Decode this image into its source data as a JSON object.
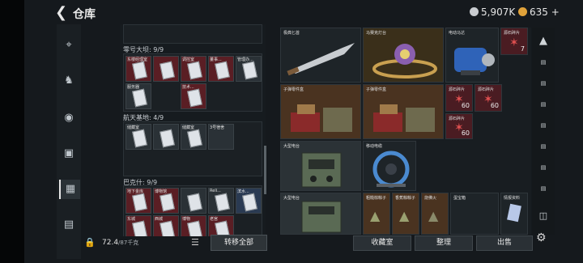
{
  "header": {
    "title": "仓库",
    "currency_silver": "5,907K",
    "currency_gold": "635",
    "gold_plus": "+"
  },
  "left_panel": {
    "sections": [
      {
        "label": "零号大坝: 9/9",
        "slots": [
          {
            "name": "东楼经理室",
            "color": "red"
          },
          {
            "name": "",
            "color": "red"
          },
          {
            "name": "调控室",
            "color": "red"
          },
          {
            "name": "董事...",
            "color": "red"
          },
          {
            "name": "管理办...",
            "color": "grey"
          },
          {
            "name": "服务器",
            "color": "grey"
          },
          {
            "name": "技术...",
            "color": "red"
          }
        ]
      },
      {
        "label": "航天基地: 4/9",
        "slots": [
          {
            "name": "储藏室",
            "color": "grey"
          },
          {
            "name": "",
            "color": "grey"
          },
          {
            "name": "储藏室",
            "color": "grey"
          },
          {
            "name": "3号宿舍",
            "color": "grey"
          }
        ]
      },
      {
        "label": "巴克什: 9/9",
        "slots": [
          {
            "name": "地下金库",
            "color": "red"
          },
          {
            "name": "博物馆",
            "color": "red"
          },
          {
            "name": "",
            "color": "grey"
          },
          {
            "name": "Reli...",
            "color": "grey"
          },
          {
            "name": "滨水...",
            "color": "blue"
          },
          {
            "name": "东城",
            "color": "red"
          },
          {
            "name": "西城",
            "color": "red"
          },
          {
            "name": "博物",
            "color": "red"
          },
          {
            "name": "老宫",
            "color": "red"
          }
        ]
      }
    ],
    "capacity": "72.4",
    "capacity_total": "/87千克",
    "transfer_all": "转移全部"
  },
  "items": [
    {
      "name": "极典匕首",
      "count": ""
    },
    {
      "name": "马赛克灯台",
      "count": ""
    },
    {
      "name": "电动马达",
      "count": ""
    },
    {
      "name": "源石碎片",
      "count": "7"
    },
    {
      "name": "子弹零件盒",
      "count": ""
    },
    {
      "name": "子弹零件盒",
      "count": ""
    },
    {
      "name": "源石碎片",
      "count": "60"
    },
    {
      "name": "源石碎片",
      "count": "60"
    },
    {
      "name": "源石碎片",
      "count": "60"
    },
    {
      "name": "大型电台",
      "count": ""
    },
    {
      "name": "移动电缆",
      "count": ""
    },
    {
      "name": "大型电台",
      "count": ""
    },
    {
      "name": "粗糙棕粽子",
      "count": ""
    },
    {
      "name": "香蕉粽粽子",
      "count": ""
    },
    {
      "name": "烧佛火",
      "count": ""
    },
    {
      "name": "蛋宝箱",
      "count": ""
    },
    {
      "name": "情报资料",
      "count": ""
    }
  ],
  "side_tabs": [
    "",
    "",
    "",
    "",
    "",
    "",
    "",
    "",
    "",
    ""
  ],
  "bottom_buttons": {
    "collection": "收藏室",
    "sort": "整理",
    "sell": "出售"
  },
  "colors": {
    "accent": "#e7e7e7",
    "slot_red": "#5a1e24",
    "coin_silver": "#c9ccd0",
    "coin_gold": "#e0a23a"
  }
}
